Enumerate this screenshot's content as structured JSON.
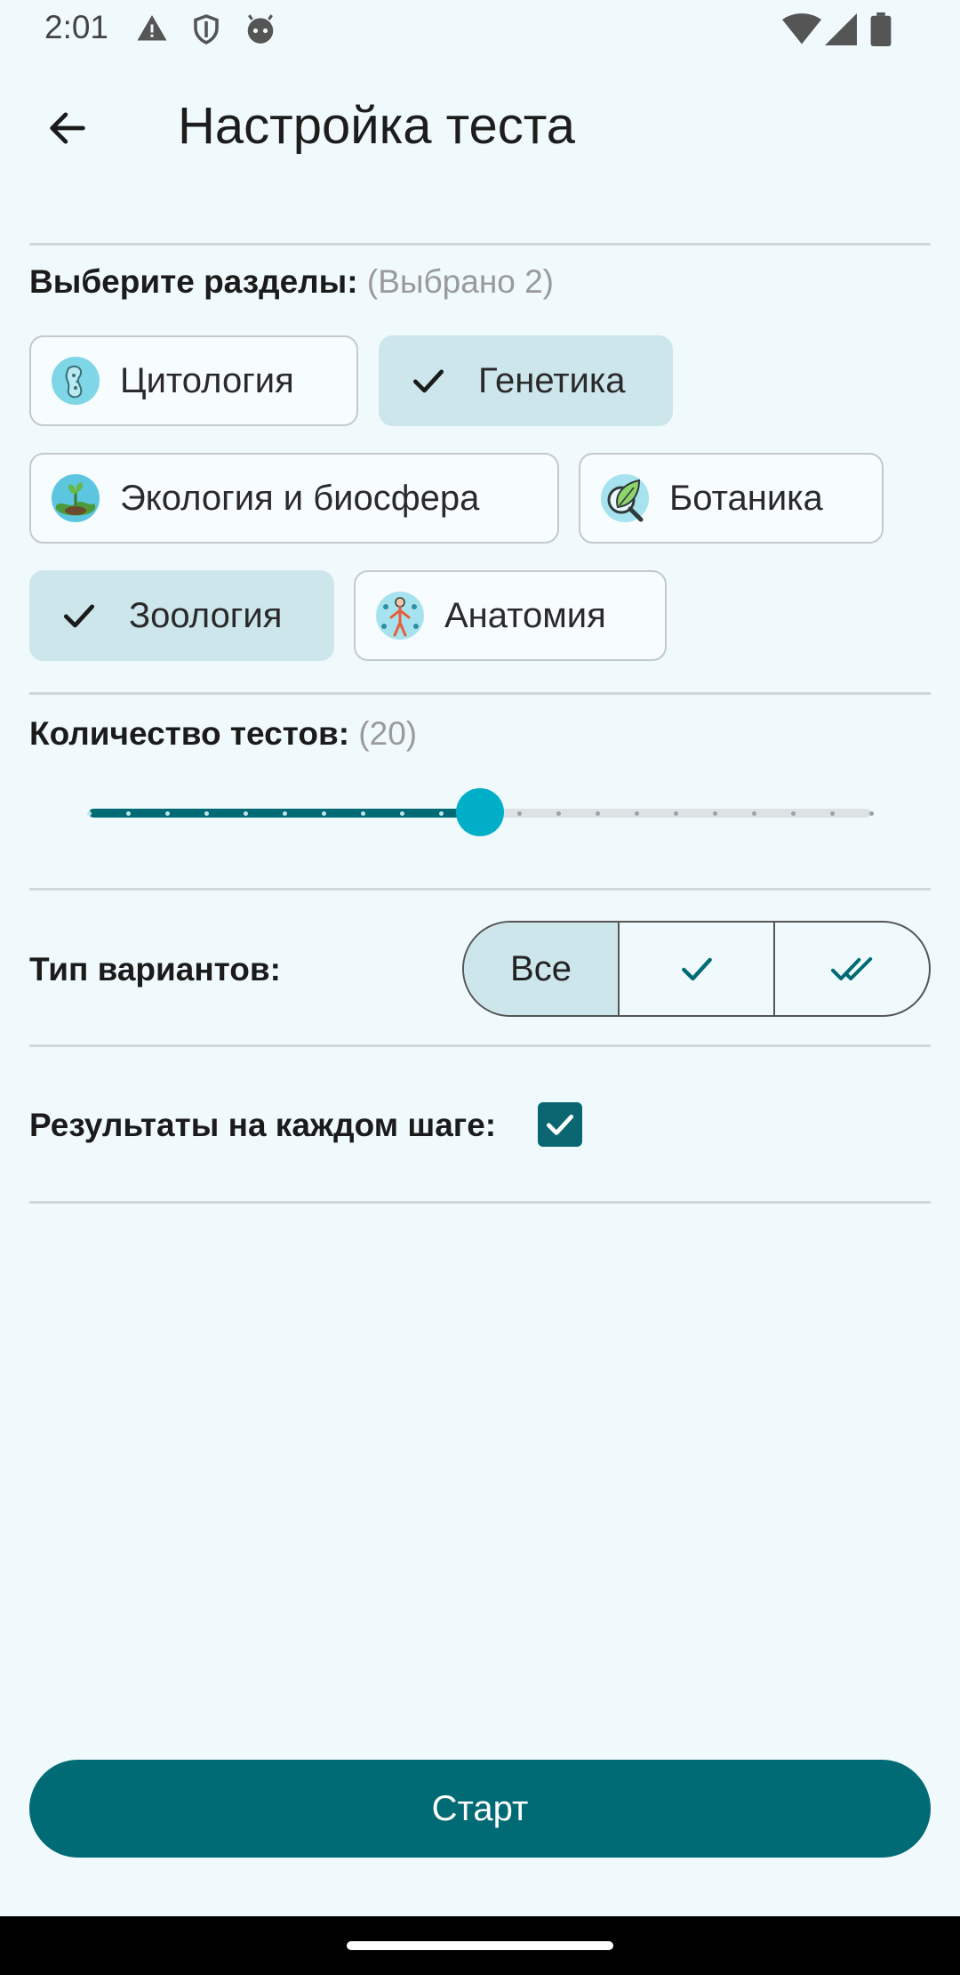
{
  "status_bar": {
    "time": "2:01",
    "left_icons": [
      "warning-icon",
      "shield-icon",
      "android-face-icon"
    ],
    "right_icons": [
      "wifi-icon",
      "signal-icon",
      "battery-icon"
    ]
  },
  "app_bar": {
    "title": "Настройка теста",
    "back_icon": "arrow-back-icon"
  },
  "sections": {
    "label": "Выберите разделы:",
    "count": "(Выбрано 2)",
    "chips": [
      {
        "label": "Цитология",
        "selected": false,
        "icon": "cell-icon"
      },
      {
        "label": "Генетика",
        "selected": true,
        "icon": "check-icon"
      },
      {
        "label": "Экология и биосфера",
        "selected": false,
        "icon": "plant-globe-icon"
      },
      {
        "label": "Ботаника",
        "selected": false,
        "icon": "leaf-magnifier-icon"
      },
      {
        "label": "Зоология",
        "selected": true,
        "icon": "check-icon"
      },
      {
        "label": "Анатомия",
        "selected": false,
        "icon": "human-body-icon"
      }
    ]
  },
  "test_count": {
    "label": "Количество тестов:",
    "value_display": "(20)",
    "value": 20,
    "steps_total": 21,
    "selected_step_index": 10
  },
  "variant_type": {
    "label": "Тип вариантов:",
    "options": [
      {
        "label": "Все",
        "icon": "",
        "active": true
      },
      {
        "label": "",
        "icon": "check-icon",
        "active": false
      },
      {
        "label": "",
        "icon": "double-check-icon",
        "active": false
      }
    ]
  },
  "step_results": {
    "label": "Результаты на каждом шаге:",
    "checked": true
  },
  "start_button": {
    "label": "Старт"
  },
  "colors": {
    "background": "#f0fafd",
    "primary": "#006b74",
    "selected_chip": "#cde6ec",
    "slider_thumb": "#00aec8"
  }
}
